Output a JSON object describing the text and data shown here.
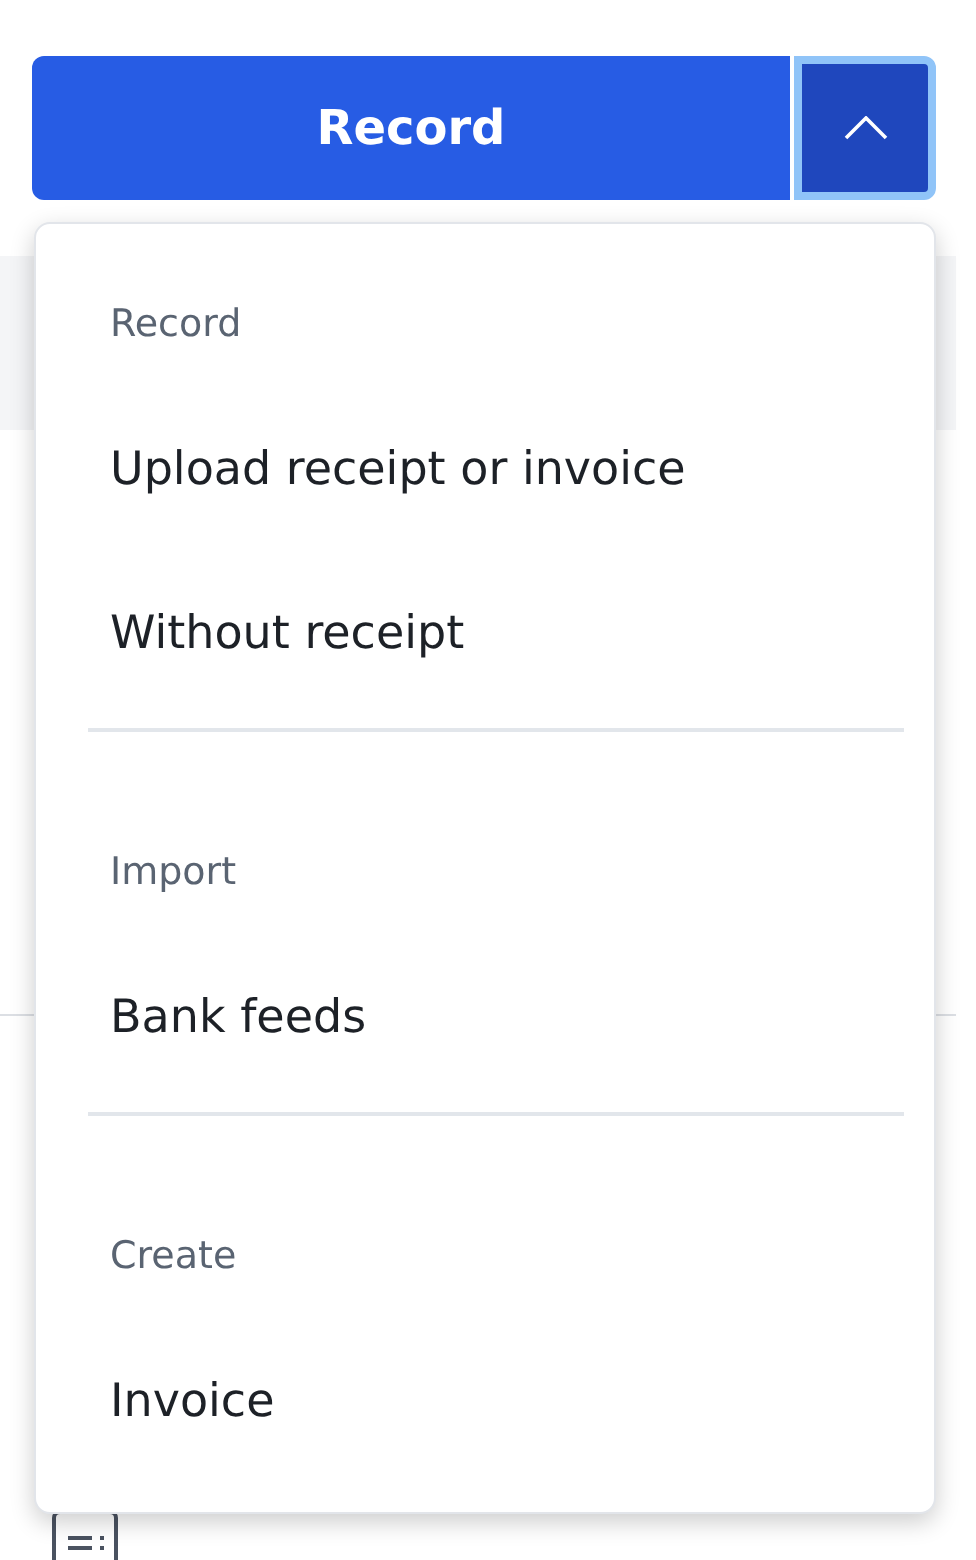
{
  "split_button": {
    "label": "Record",
    "menu_expanded": true
  },
  "menu": {
    "sections": [
      {
        "title": "Record",
        "items": [
          {
            "label": "Upload receipt or invoice"
          },
          {
            "label": "Without receipt"
          }
        ]
      },
      {
        "title": "Import",
        "items": [
          {
            "label": "Bank feeds"
          }
        ]
      },
      {
        "title": "Create",
        "items": [
          {
            "label": "Invoice"
          }
        ]
      }
    ]
  }
}
